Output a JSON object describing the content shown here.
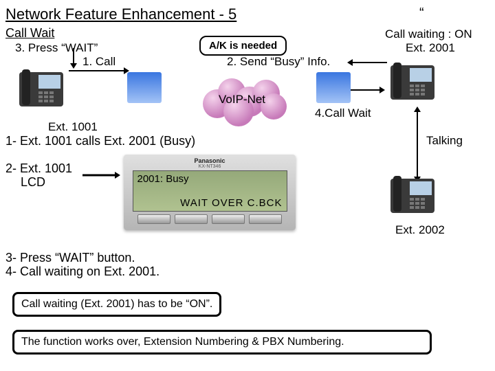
{
  "title": "Network Feature Enhancement - 5",
  "subtitle": "Call Wait",
  "quote_mark": "“",
  "labels": {
    "press_wait": "3. Press “WAIT”",
    "call1": "1. Call",
    "ak_needed": "A/K is needed",
    "send_busy": "2. Send “Busy” Info.",
    "voip_net": "VoIP-Net",
    "call_wait4": "4.Call Wait",
    "call_waiting_on": "Call waiting : ON",
    "ext2001_top": "Ext. 2001",
    "ext1001": "Ext. 1001",
    "talking": "Talking",
    "ext2002": "Ext. 2002",
    "line1": "1- Ext. 1001 calls Ext. 2001 (Busy)",
    "line2a": "2- Ext. 1001",
    "line2b": "LCD",
    "line3": "3- Press “WAIT” button.",
    "line4": "4- Call waiting on Ext. 2001.",
    "note1": "Call waiting (Ext. 2001) has to be “ON”.",
    "note2": "The function works over, Extension Numbering & PBX Numbering."
  },
  "lcd": {
    "brand": "Panasonic",
    "model": "KX-NT346",
    "top_line": "2001: Busy",
    "bottom_line": "WAIT  OVER  C.BCK"
  }
}
